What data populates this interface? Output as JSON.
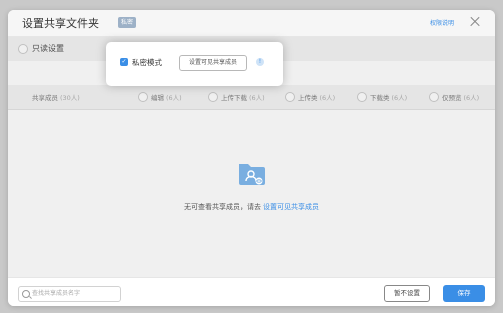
{
  "dialog": {
    "title": "设置共享文件夹",
    "tag": "私密",
    "help_link": "权限说明"
  },
  "readonly_option": {
    "label": "只读设置"
  },
  "members_header": {
    "label": "共享成员",
    "count": "(30人)"
  },
  "permissions": [
    {
      "label": "编辑",
      "count": "(6人)"
    },
    {
      "label": "上传下载",
      "count": "(6人)"
    },
    {
      "label": "上传类",
      "count": "(6人)"
    },
    {
      "label": "下载类",
      "count": "(6人)"
    },
    {
      "label": "仅预览",
      "count": "(6人)"
    }
  ],
  "private_popup": {
    "checkbox_label": "私密模式",
    "checked": true,
    "button_label": "设置可见共享成员",
    "info": "!"
  },
  "empty_state": {
    "message": "无可查看共享成员，请去",
    "link": "设置可见共享成员"
  },
  "footer": {
    "search_placeholder": "查找共享成员名字",
    "skip_button": "暂不设置",
    "save_button": "保存"
  },
  "colors": {
    "accent": "#3a8ee6",
    "tag_bg": "#9db1c7"
  }
}
